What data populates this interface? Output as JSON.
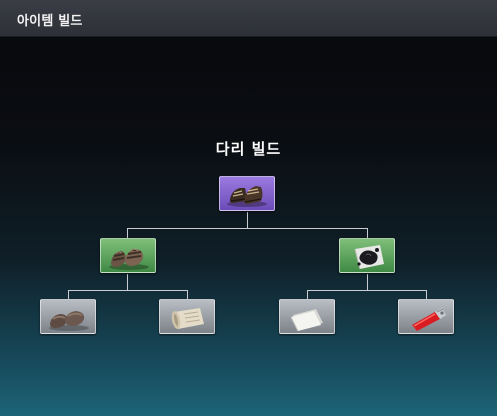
{
  "window": {
    "title": "아이템 빌드"
  },
  "build": {
    "name": "다리 빌드",
    "root": {
      "icon": "boots-icon",
      "tier": "epic"
    },
    "left": {
      "item": {
        "icon": "sandals-icon",
        "tier": "uncommon"
      },
      "children": [
        {
          "icon": "slippers-icon",
          "tier": "common"
        },
        {
          "icon": "scroll-icon",
          "tier": "common"
        }
      ]
    },
    "right": {
      "item": {
        "icon": "stained-cloth-icon",
        "tier": "uncommon"
      },
      "children": [
        {
          "icon": "paper-icon",
          "tier": "common"
        },
        {
          "icon": "lighter-icon",
          "tier": "common"
        }
      ]
    }
  },
  "colors": {
    "epic": "#7b5bcc",
    "uncommon": "#5aa05a",
    "common": "#9aa0a6",
    "background_bottom": "#1d6478"
  }
}
